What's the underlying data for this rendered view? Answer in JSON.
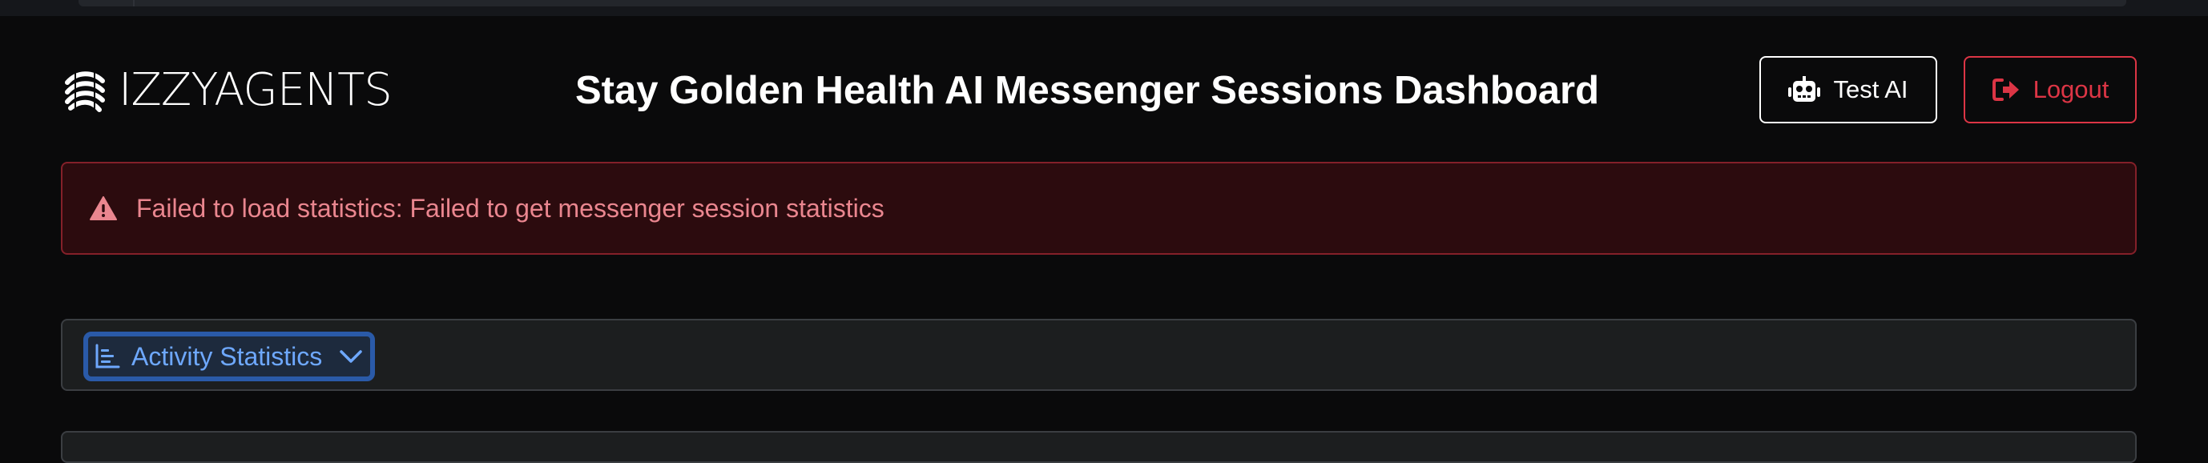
{
  "brand": {
    "logo_text": "IZZYAGENTS"
  },
  "header": {
    "title": "Stay Golden Health AI Messenger Sessions Dashboard",
    "test_button_label": "Test AI",
    "logout_button_label": "Logout"
  },
  "alert": {
    "message": "Failed to load statistics: Failed to get messenger session statistics",
    "type": "danger"
  },
  "accordion": {
    "label": "Activity Statistics",
    "icon": "chart-bar-icon",
    "state": "collapsed"
  },
  "colors": {
    "background": "#0a0a0b",
    "danger": "#dc3545",
    "danger_text": "#ea868f",
    "danger_bg": "#2c0b0e",
    "accent": "#6ea8fe"
  }
}
